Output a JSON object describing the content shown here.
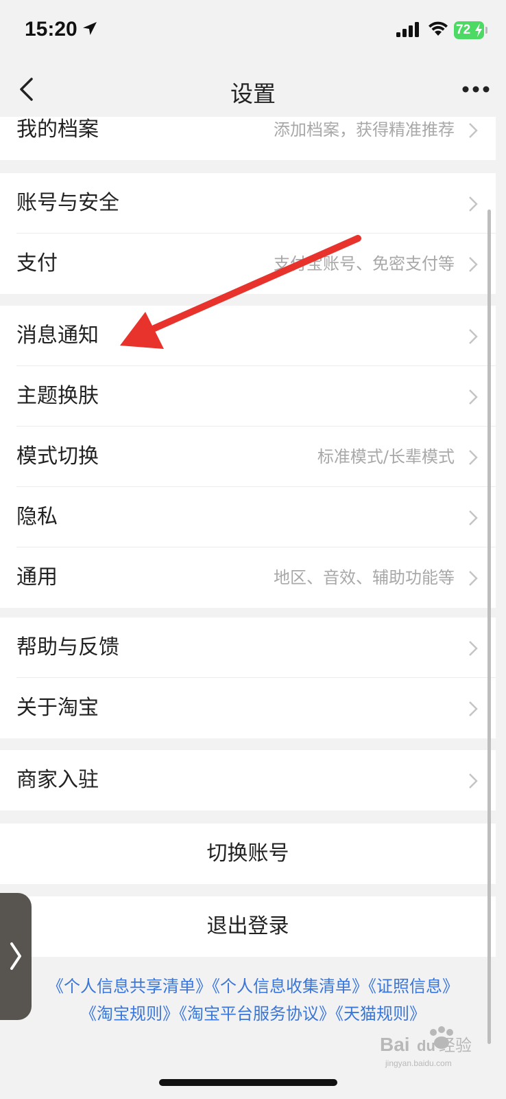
{
  "status_bar": {
    "time": "15:20",
    "battery": "72",
    "icons": [
      "location-arrow-icon",
      "signal-icon",
      "wifi-icon",
      "battery-charging-icon"
    ]
  },
  "nav": {
    "title": "设置",
    "back_icon": "chevron-left-icon",
    "more_icon": "more-dots-icon"
  },
  "groups": [
    {
      "items": [
        {
          "label": "我的档案",
          "sub": "添加档案，获得精准推荐"
        }
      ]
    },
    {
      "items": [
        {
          "label": "账号与安全",
          "sub": ""
        },
        {
          "label": "支付",
          "sub": "支付宝账号、免密支付等"
        }
      ]
    },
    {
      "items": [
        {
          "label": "消息通知",
          "sub": ""
        },
        {
          "label": "主题换肤",
          "sub": ""
        },
        {
          "label": "模式切换",
          "sub": "标准模式/长辈模式"
        },
        {
          "label": "隐私",
          "sub": ""
        },
        {
          "label": "通用",
          "sub": "地区、音效、辅助功能等"
        }
      ]
    },
    {
      "items": [
        {
          "label": "帮助与反馈",
          "sub": ""
        },
        {
          "label": "关于淘宝",
          "sub": ""
        }
      ]
    },
    {
      "items": [
        {
          "label": "商家入驻",
          "sub": ""
        }
      ]
    }
  ],
  "actions": {
    "switch_account": "切换账号",
    "logout": "退出登录"
  },
  "links": {
    "line1": [
      "《个人信息共享清单》",
      "《个人信息收集清单》",
      "《证照信息》"
    ],
    "line2": [
      "《淘宝规则》",
      "《淘宝平台服务协议》",
      "《天猫规则》"
    ]
  },
  "side_tab": {
    "icon": "chevron-right-icon"
  },
  "watermark": {
    "brand": "Bai",
    "brand2": "du",
    "text": "经验",
    "sub": "jingyan.baidu.com"
  },
  "annotation": {
    "icon": "red-arrow-icon",
    "color": "#e8322c"
  },
  "colors": {
    "link": "#3a76d8",
    "secondary_text": "#a8a8a8",
    "background": "#f2f2f2"
  }
}
